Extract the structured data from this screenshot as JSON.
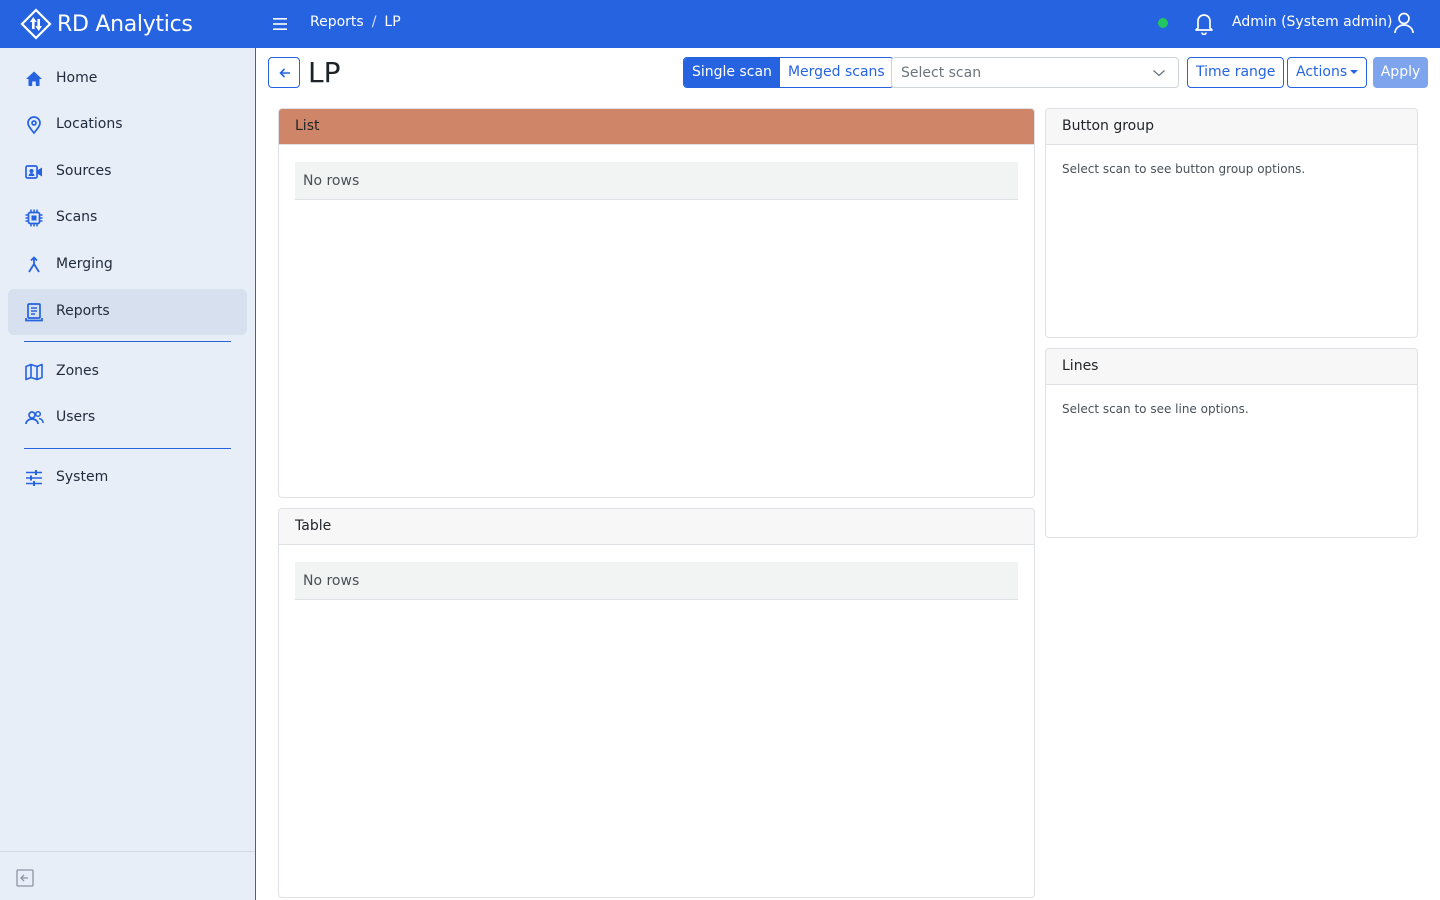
{
  "header": {
    "brand": "RD Analytics",
    "breadcrumb": [
      "Reports",
      "LP"
    ],
    "breadcrumb_separator": "/",
    "user": "Admin (System admin)",
    "status_color": "#22c55e",
    "accent": "#2563e1"
  },
  "sidebar": {
    "items": [
      {
        "label": "Home",
        "icon": "home-icon"
      },
      {
        "label": "Locations",
        "icon": "map-pin-icon"
      },
      {
        "label": "Sources",
        "icon": "camera-icon"
      },
      {
        "label": "Scans",
        "icon": "chip-icon"
      },
      {
        "label": "Merging",
        "icon": "merge-icon"
      },
      {
        "label": "Reports",
        "icon": "report-icon",
        "active": true
      },
      {
        "label": "Zones",
        "icon": "map-icon"
      },
      {
        "label": "Users",
        "icon": "users-icon"
      },
      {
        "label": "System",
        "icon": "sliders-icon"
      }
    ]
  },
  "toolbar": {
    "title": "LP",
    "modes": [
      "Single scan",
      "Merged scans"
    ],
    "active_mode": "Single scan",
    "scan_placeholder": "Select scan",
    "time_range": "Time range",
    "actions": "Actions",
    "apply": "Apply"
  },
  "cards": {
    "list": {
      "title": "List",
      "empty": "No rows",
      "highlight_color": "#cf8668"
    },
    "table": {
      "title": "Table",
      "empty": "No rows"
    },
    "button_group": {
      "title": "Button group",
      "message": "Select scan to see button group options."
    },
    "lines": {
      "title": "Lines",
      "message": "Select scan to see line options."
    }
  }
}
